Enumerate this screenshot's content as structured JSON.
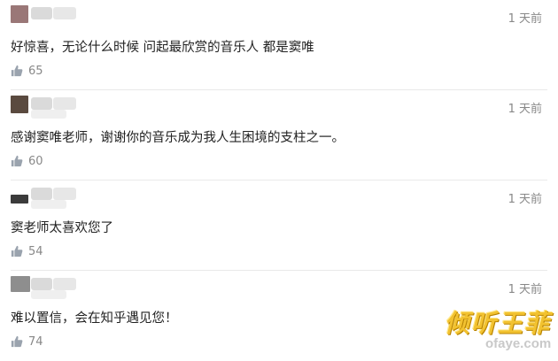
{
  "comments": [
    {
      "avatar_color": "#9a7777",
      "time": "1 天前",
      "content": "好惊喜，无论什么时候 问起最欣赏的音乐人 都是窦唯",
      "likes": "65"
    },
    {
      "avatar_color": "#5a4a3f",
      "time": "1 天前",
      "content": "感谢窦唯老师，谢谢你的音乐成为我人生困境的支柱之一。",
      "likes": "60"
    },
    {
      "avatar_color": "#3b3b3b",
      "time": "1 天前",
      "content": "窦老师太喜欢您了",
      "likes": "54"
    },
    {
      "avatar_color": "#8e8e8e",
      "time": "1 天前",
      "content": "难以置信，会在知乎遇见您！",
      "likes": "74"
    }
  ],
  "icons": {
    "like": "thumb-up-icon"
  },
  "watermark": {
    "main": "倾听王菲",
    "sub": "ofaye.com"
  }
}
